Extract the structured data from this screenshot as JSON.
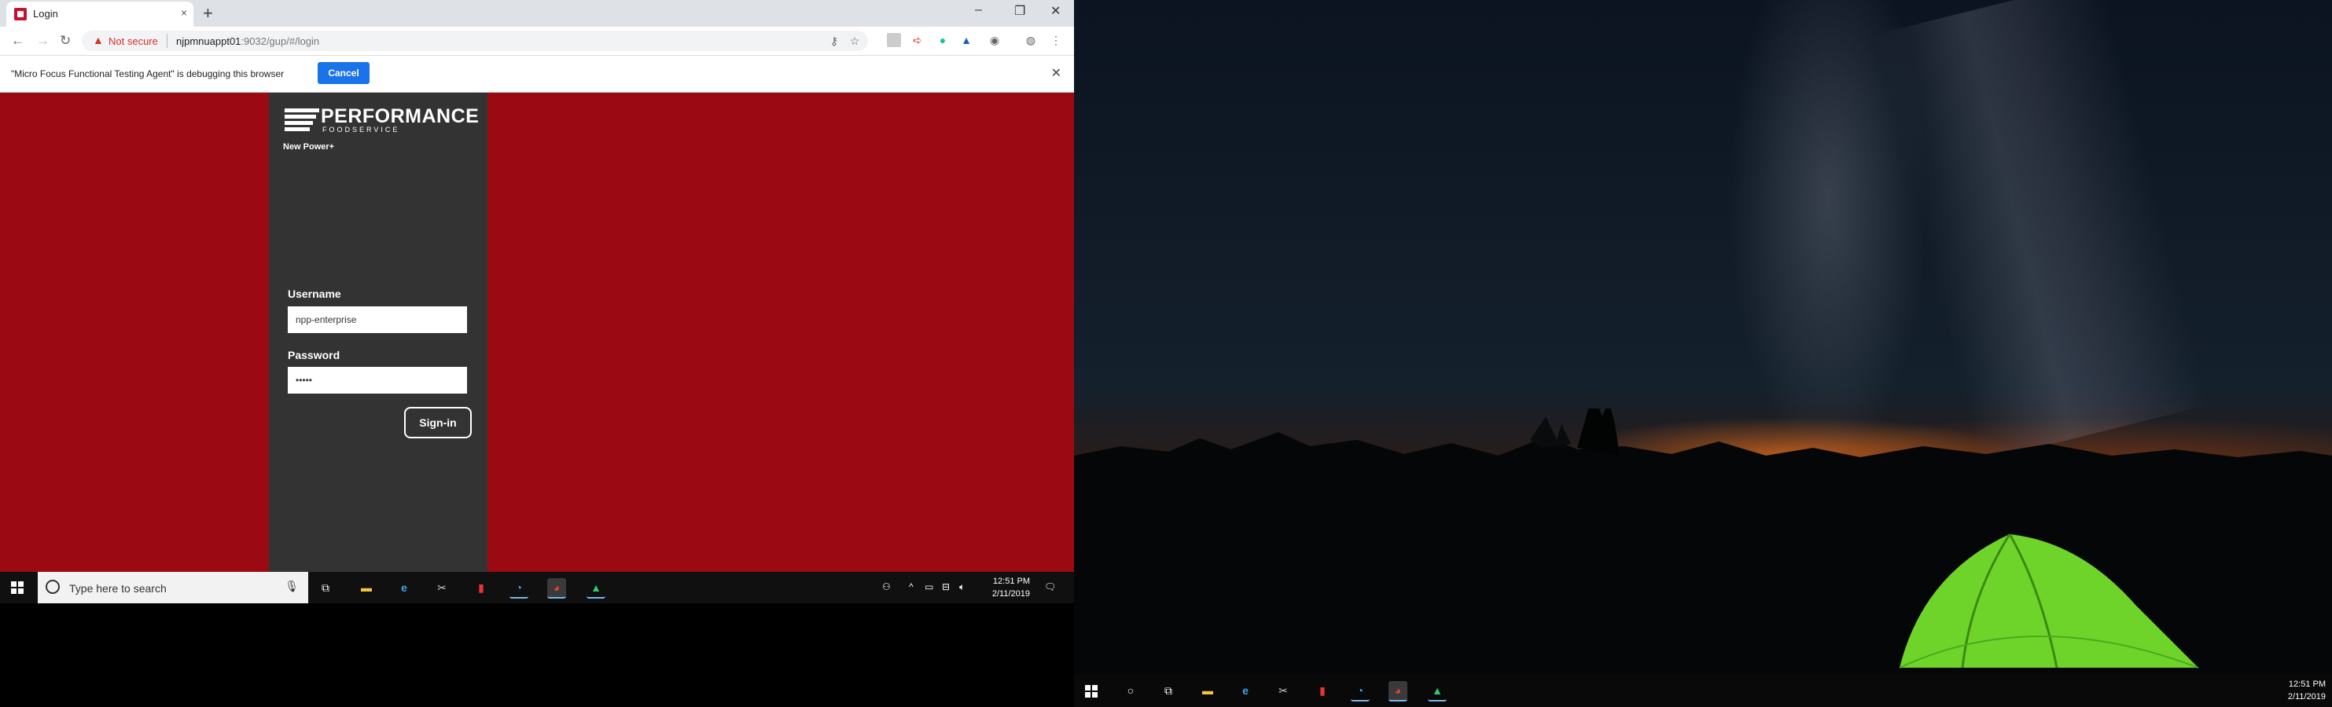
{
  "browser": {
    "tab_title": "Login",
    "tab_close": "×",
    "new_tab": "+",
    "window_controls": {
      "minimize": "–",
      "restore": "❐",
      "close": "✕"
    },
    "nav": {
      "back": "←",
      "forward": "→",
      "reload": "↻"
    },
    "address": {
      "security_label": "Not secure",
      "host": "njpmnuappt01",
      "path": ":9032/gup/#/login"
    },
    "infobar": {
      "message": "\"Micro Focus Functional Testing Agent\" is debugging this browser",
      "cancel_label": "Cancel",
      "close": "✕"
    }
  },
  "login": {
    "brand": "PERFORMANCE",
    "brand_sub": "FOODSERVICE",
    "app_name": "New Power+",
    "username_label": "Username",
    "username_value": "npp-enterprise",
    "password_label": "Password",
    "password_value": "•••••",
    "signin_label": "Sign-in"
  },
  "taskbar_left": {
    "search_placeholder": "Type here to search",
    "clock_time": "12:51 PM",
    "clock_date": "2/11/2019"
  },
  "taskbar_right": {
    "clock_time": "12:51 PM",
    "clock_date": "2/11/2019"
  }
}
